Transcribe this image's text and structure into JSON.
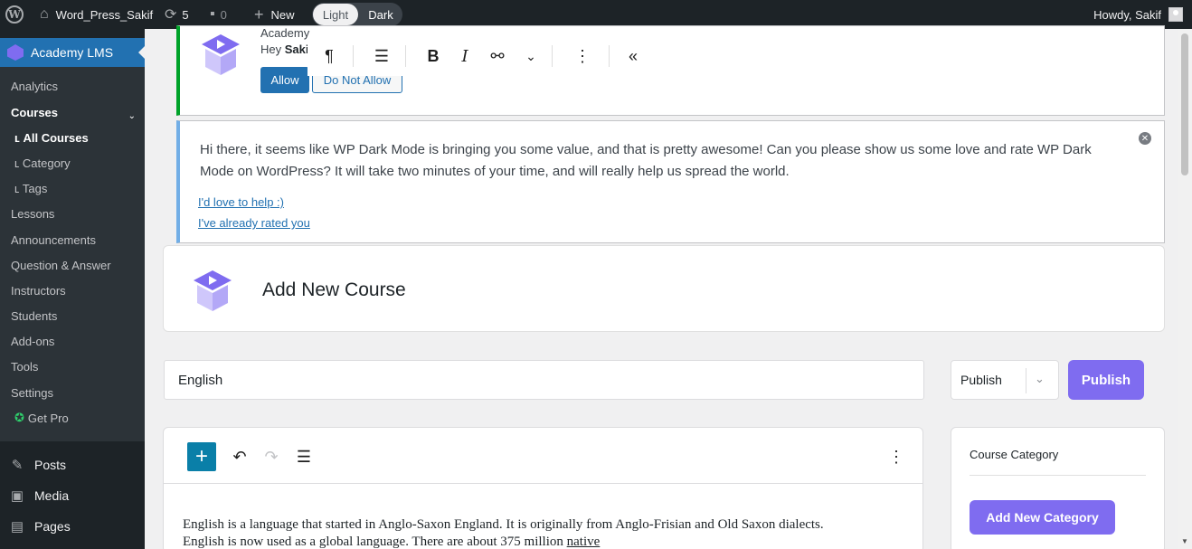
{
  "adminbar": {
    "site_name": "Word_Press_Sakif",
    "updates_count": "5",
    "comments_count": "0",
    "new_label": "New",
    "toggle_light": "Light",
    "toggle_dark": "Dark",
    "howdy": "Howdy, Sakif"
  },
  "sidebar": {
    "current": "Academy LMS",
    "submenu": [
      "Analytics",
      "Courses",
      "All Courses",
      "Category",
      "Tags",
      "Lessons",
      "Announcements",
      "Question & Answer",
      "Instructors",
      "Students",
      "Add-ons",
      "Tools",
      "Settings",
      "Get Pro"
    ],
    "main": [
      "Posts",
      "Media",
      "Pages"
    ]
  },
  "notice1": {
    "title": "Academy",
    "hey": "Hey ",
    "user": "Sakif",
    "allow": "Allow",
    "deny": "Do Not Allow"
  },
  "notice2": {
    "text": "Hi there, it seems like WP Dark Mode is bringing you some value, and that is pretty awesome! Can you please show us some love and rate WP Dark Mode on WordPress? It will take two minutes of your time, and will really help us spread the world.",
    "link1": "I'd love to help :)",
    "link2": "I've already rated you"
  },
  "course": {
    "heading": "Add New Course",
    "title_value": "English",
    "status": "Publish",
    "publish_button": "Publish",
    "body_line1": "English is a language that started in Anglo-Saxon England. It is originally from Anglo-Frisian and Old Saxon dialects.",
    "body_line2": "English is now used as a global language. There are about 375 million ",
    "body_link": "native"
  },
  "category": {
    "title": "Course Category",
    "add_button": "Add New Category"
  },
  "colors": {
    "accent": "#7f6cf0",
    "wp_blue": "#2271b1",
    "admin_dark": "#1d2327"
  }
}
